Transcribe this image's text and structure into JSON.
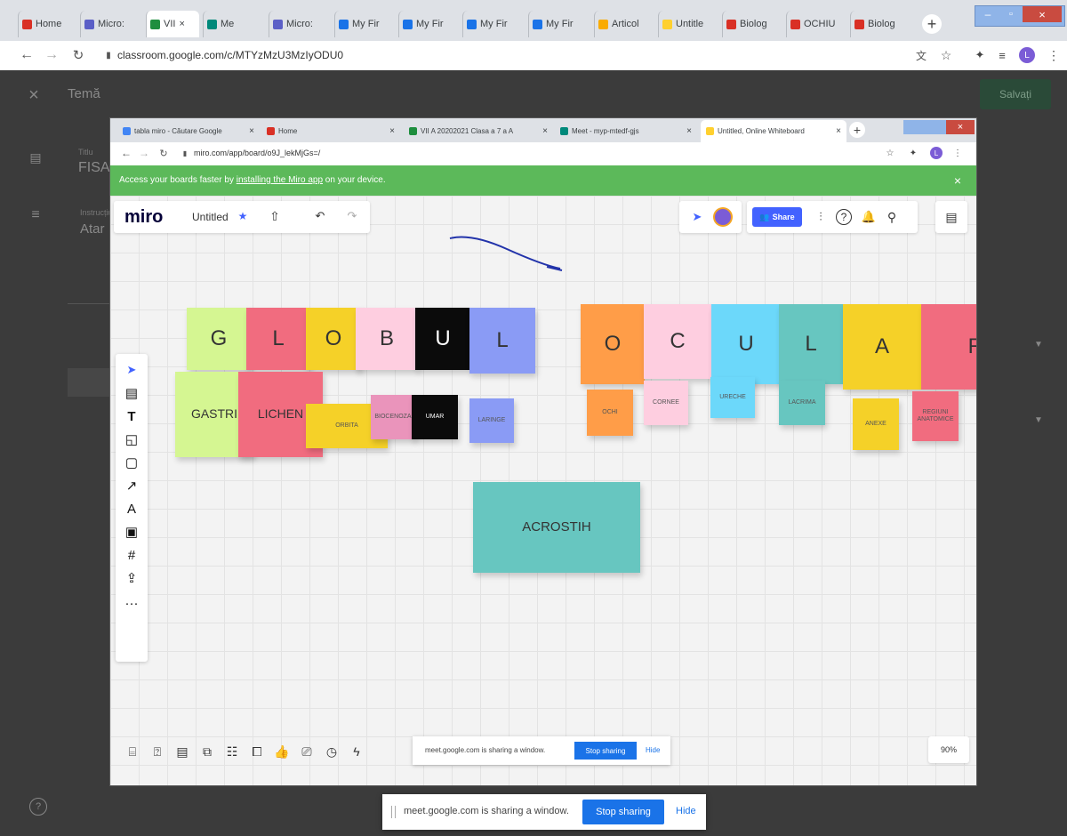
{
  "outer": {
    "tabs": [
      {
        "label": "Home",
        "color": "#d93025"
      },
      {
        "label": "Micro:",
        "color": "#5b5fc7"
      },
      {
        "label": "VII",
        "color": "#1e8e3e",
        "close": "×"
      },
      {
        "label": "Me",
        "color": "#00897b"
      },
      {
        "label": "Micro:",
        "color": "#5b5fc7"
      },
      {
        "label": "My Fir",
        "color": "#1a73e8"
      },
      {
        "label": "My Fir",
        "color": "#1a73e8"
      },
      {
        "label": "My Fir",
        "color": "#1a73e8"
      },
      {
        "label": "My Fir",
        "color": "#1a73e8"
      },
      {
        "label": "Articol",
        "color": "#f9ab00"
      },
      {
        "label": "Untitle",
        "color": "#ffd02f"
      },
      {
        "label": "Biolog",
        "color": "#d93025"
      },
      {
        "label": "OCHIU",
        "color": "#d93025"
      },
      {
        "label": "Biolog",
        "color": "#d93025"
      }
    ],
    "url": "classroom.google.com/c/MTYzMzU3MzIyODU0",
    "profile_initial": "L"
  },
  "classroom": {
    "title": "Temă",
    "save_label": "Salvați",
    "field_title": "FISA",
    "field_title_label": "Titlu",
    "field_instr": "Atar",
    "field_instr_label": "Instrucțiuni"
  },
  "inner": {
    "tabs": [
      {
        "label": "tabla miro - Căutare Google",
        "color": "#4285f4"
      },
      {
        "label": "Home",
        "color": "#d93025"
      },
      {
        "label": "VII A 20202021 Clasa a 7 a A",
        "color": "#1e8e3e"
      },
      {
        "label": "Meet - myp-mtedf-gjs",
        "color": "#00897b"
      },
      {
        "label": "Untitled, Online Whiteboard",
        "color": "#ffd02f"
      }
    ],
    "url": "miro.com/app/board/o9J_lekMjGs=/",
    "banner_text": "Access your boards faster by ",
    "banner_link": "installing the Miro app",
    "banner_rest": " on your device.",
    "profile_initial": "L"
  },
  "miro": {
    "logo": "miro",
    "board_name": "Untitled",
    "share_label": "Share",
    "zoom": "90%"
  },
  "notes_big": [
    {
      "text": "G",
      "color": "#d5f692"
    },
    {
      "text": "L",
      "color": "#f16c7f"
    },
    {
      "text": "O",
      "color": "#f5d128"
    },
    {
      "text": "B",
      "color": "#fecee0"
    },
    {
      "text": "U",
      "color": "#0b0b0b"
    },
    {
      "text": "L",
      "color": "#8a9bf5"
    },
    {
      "text": "O",
      "color": "#ff9d48"
    },
    {
      "text": "C",
      "color": "#fecee0"
    },
    {
      "text": "U",
      "color": "#6cd8fa"
    },
    {
      "text": "L",
      "color": "#67c6c0"
    },
    {
      "text": "A",
      "color": "#f5d128"
    },
    {
      "text": "R",
      "color": "#f16c7f"
    }
  ],
  "notes_small": [
    {
      "text": "GASTRI",
      "color": "#d5f692"
    },
    {
      "text": "LICHEN",
      "color": "#f16c7f"
    },
    {
      "text": "ORBITA",
      "color": "#f5d128"
    },
    {
      "text": "BIOCENOZA",
      "color": "#ea94bb"
    },
    {
      "text": "UMAR",
      "color": "#0b0b0b"
    },
    {
      "text": "LARINGE",
      "color": "#8a9bf5"
    },
    {
      "text": "OCHI",
      "color": "#ff9d48"
    },
    {
      "text": "CORNEE",
      "color": "#fecee0"
    },
    {
      "text": "URECHE",
      "color": "#6cd8fa"
    },
    {
      "text": "LACRIMA",
      "color": "#67c6c0"
    },
    {
      "text": "ANEXE",
      "color": "#f5d128"
    },
    {
      "text": "REGIUNI ANATOMICE",
      "color": "#f16c7f"
    }
  ],
  "acrostih": {
    "text": "ACROSTIH",
    "color": "#67c6c0"
  },
  "share_bar": {
    "message": "meet.google.com is sharing a window.",
    "stop": "Stop sharing",
    "hide": "Hide"
  }
}
